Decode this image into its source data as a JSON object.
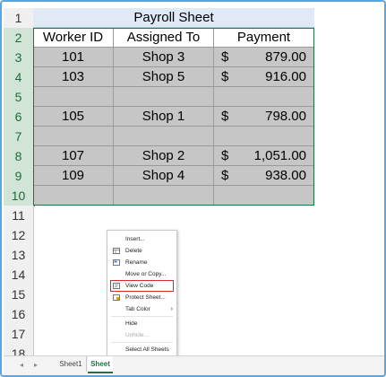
{
  "rows": [
    "1",
    "2",
    "3",
    "4",
    "5",
    "6",
    "7",
    "8",
    "9",
    "10",
    "11",
    "12",
    "13",
    "14",
    "15",
    "16",
    "17",
    "18"
  ],
  "table": {
    "title": "Payroll Sheet",
    "headers": [
      "Worker ID",
      "Assigned To",
      "Payment"
    ],
    "data": [
      {
        "id": "101",
        "shop": "Shop 3",
        "cur": "$",
        "amount": "879.00"
      },
      {
        "id": "103",
        "shop": "Shop 5",
        "cur": "$",
        "amount": "916.00"
      },
      {
        "id": "",
        "shop": "",
        "cur": "",
        "amount": ""
      },
      {
        "id": "105",
        "shop": "Shop 1",
        "cur": "$",
        "amount": "798.00"
      },
      {
        "id": "",
        "shop": "",
        "cur": "",
        "amount": ""
      },
      {
        "id": "107",
        "shop": "Shop 2",
        "cur": "$",
        "amount": "1,051.00"
      },
      {
        "id": "109",
        "shop": "Shop 4",
        "cur": "$",
        "amount": "938.00"
      },
      {
        "id": "",
        "shop": "",
        "cur": "",
        "amount": ""
      }
    ]
  },
  "context_menu": {
    "insert": "Insert...",
    "delete": "Delete",
    "rename": "Rename",
    "move_copy": "Move or Copy...",
    "view_code": "View Code",
    "protect": "Protect Sheet...",
    "tab_color": "Tab Color",
    "hide": "Hide",
    "unhide": "Unhide...",
    "select_all": "Select All Sheets"
  },
  "tabs": {
    "sheet1": "Sheet1",
    "active": "Sheet"
  },
  "colors": {
    "accent": "#217346",
    "highlight": "#d42b2b",
    "grey_fill": "#c6c6c6",
    "title_fill": "#dfeaf6"
  }
}
